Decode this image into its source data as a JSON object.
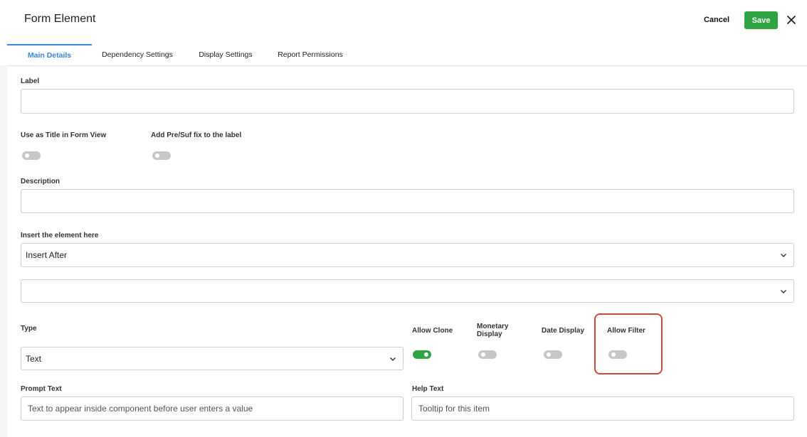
{
  "header": {
    "title": "Form Element",
    "cancel_label": "Cancel",
    "save_label": "Save"
  },
  "tabs": [
    {
      "label": "Main Details",
      "active": true
    },
    {
      "label": "Dependency Settings",
      "active": false
    },
    {
      "label": "Display Settings",
      "active": false
    },
    {
      "label": "Report Permissions",
      "active": false
    }
  ],
  "form": {
    "label_field": {
      "label": "Label",
      "value": ""
    },
    "use_as_title": {
      "label": "Use as Title in Form View",
      "on": false
    },
    "add_prefix": {
      "label": "Add Pre/Suf fix to the label",
      "on": false
    },
    "description": {
      "label": "Description",
      "value": ""
    },
    "insert": {
      "label": "Insert the element here",
      "value": "Insert After"
    },
    "insert_target": {
      "value": ""
    },
    "type": {
      "label": "Type",
      "value": "Text"
    },
    "allow_clone": {
      "label": "Allow Clone",
      "on": true
    },
    "monetary_display": {
      "label": "Monetary\nDisplay",
      "on": false
    },
    "date_display": {
      "label": "Date Display",
      "on": false
    },
    "allow_filter": {
      "label": "Allow Filter",
      "on": false
    },
    "prompt_text": {
      "label": "Prompt Text",
      "placeholder": "Text to appear inside component before user enters a value"
    },
    "help_text": {
      "label": "Help Text",
      "placeholder": "Tooltip for this item"
    }
  },
  "colors": {
    "accent": "#3a86e0",
    "save": "#2ea443",
    "highlight": "#d24a37"
  }
}
